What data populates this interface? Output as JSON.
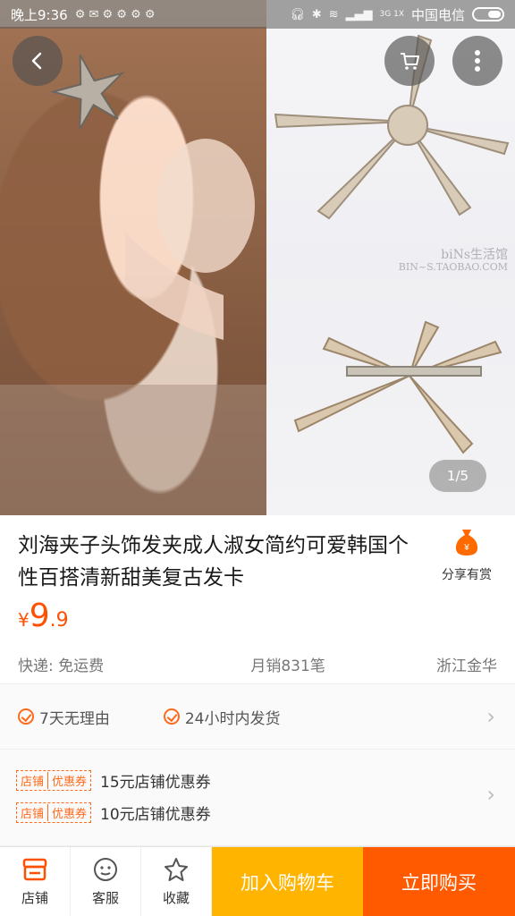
{
  "status_bar": {
    "time": "晚上9:36",
    "network": "3G 1X",
    "carrier": "中国电信"
  },
  "hero": {
    "watermark_line1": "biNs生活馆",
    "watermark_line2": "BIN~S.TAOBAO.COM",
    "page_indicator": "1/5",
    "icons": {
      "back": "back-arrow-icon",
      "cart": "cart-icon",
      "more": "more-vertical-icon"
    }
  },
  "product": {
    "title": "刘海夹子头饰发夹成人淑女简约可爱韩国个性百搭清新甜美复古发卡",
    "price_symbol": "¥",
    "price_integer": "9",
    "price_decimal": ".9",
    "shipping": "快递: 免运费",
    "monthly_sales": "月销831笔",
    "location": "浙江金华"
  },
  "share": {
    "label": "分享有赏"
  },
  "services": [
    {
      "label": "7天无理由"
    },
    {
      "label": "24小时内发货"
    }
  ],
  "coupons": [
    {
      "tag_a": "店铺",
      "tag_b": "优惠券",
      "text": "15元店铺优惠券"
    },
    {
      "tag_a": "店铺",
      "tag_b": "优惠券",
      "text": "10元店铺优惠券"
    }
  ],
  "bottom_bar": {
    "shop": "店铺",
    "service": "客服",
    "favorite": "收藏",
    "add_to_cart": "加入购物车",
    "buy_now": "立即购买"
  },
  "colors": {
    "accent": "#ff5000",
    "cart_button": "#ffb400",
    "buy_button": "#ff5a00"
  }
}
